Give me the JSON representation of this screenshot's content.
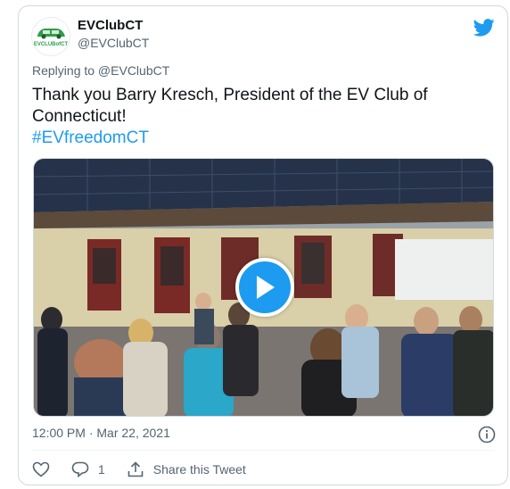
{
  "tweet": {
    "display_name": "EVClubCT",
    "handle": "@EVClubCT",
    "replying_to": "Replying to @EVClubCT",
    "text_line1": "Thank you Barry Kresch, President of the EV Club of",
    "text_line2": "Connecticut!",
    "hashtag": "#EVfreedomCT",
    "timestamp": "12:00 PM · Mar 22, 2021",
    "reply_count": "1",
    "share_label": "Share this Tweet",
    "avatar_logo_text": "EVCLUBofCT"
  },
  "icons": {
    "brand": "twitter-bird-icon",
    "media": "play-icon",
    "info": "info-icon",
    "like": "heart-icon",
    "reply": "reply-bubble-icon",
    "share": "share-icon"
  },
  "colors": {
    "accent": "#1d9bf0",
    "text": "#0f1419",
    "muted": "#536471",
    "border": "#cfd9de",
    "logo_green": "#2e9e48"
  }
}
